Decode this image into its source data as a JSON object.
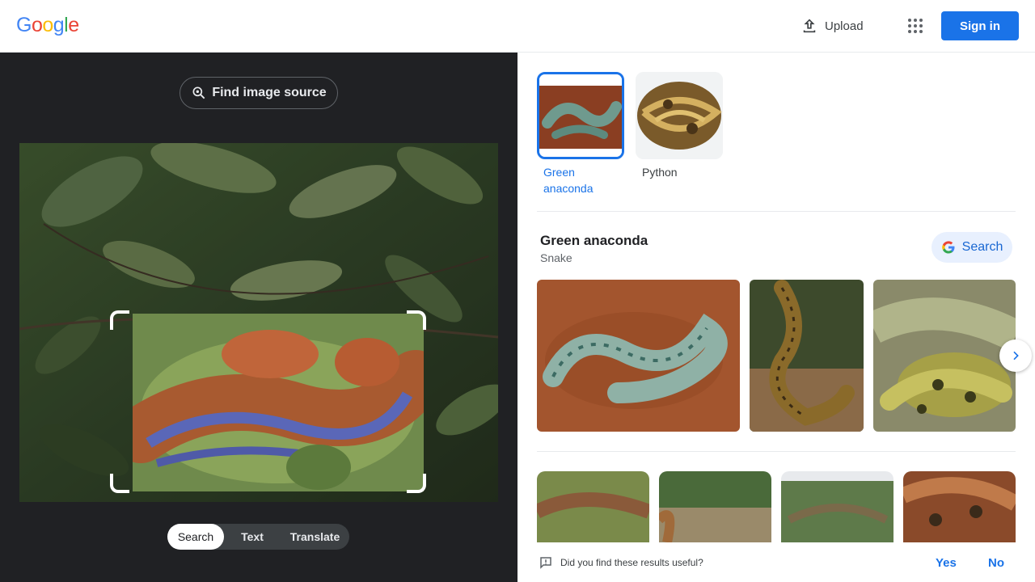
{
  "header": {
    "logo": [
      "G",
      "o",
      "o",
      "g",
      "l",
      "e"
    ],
    "logo_colors": [
      "#4285f4",
      "#ea4335",
      "#fbbc05",
      "#4285f4",
      "#34a853",
      "#ea4335"
    ],
    "upload_label": "Upload",
    "signin_label": "Sign in"
  },
  "lens": {
    "find_source_label": "Find image source",
    "modes": [
      "Search",
      "Text",
      "Translate"
    ],
    "active_mode": "Search"
  },
  "candidates": [
    {
      "label": "Green anaconda",
      "selected": true
    },
    {
      "label": "Python",
      "selected": false
    }
  ],
  "entity": {
    "title": "Green anaconda",
    "subtitle": "Snake",
    "search_label": "Search"
  },
  "feedback": {
    "question": "Did you find these results useful?",
    "yes": "Yes",
    "no": "No"
  },
  "colors": {
    "accent": "#1a73e8",
    "dark_pane": "#202124"
  },
  "icons": [
    "upload-icon",
    "apps-grid-icon",
    "lens-search-icon",
    "google-g-icon",
    "chevron-right-icon",
    "feedback-icon"
  ]
}
